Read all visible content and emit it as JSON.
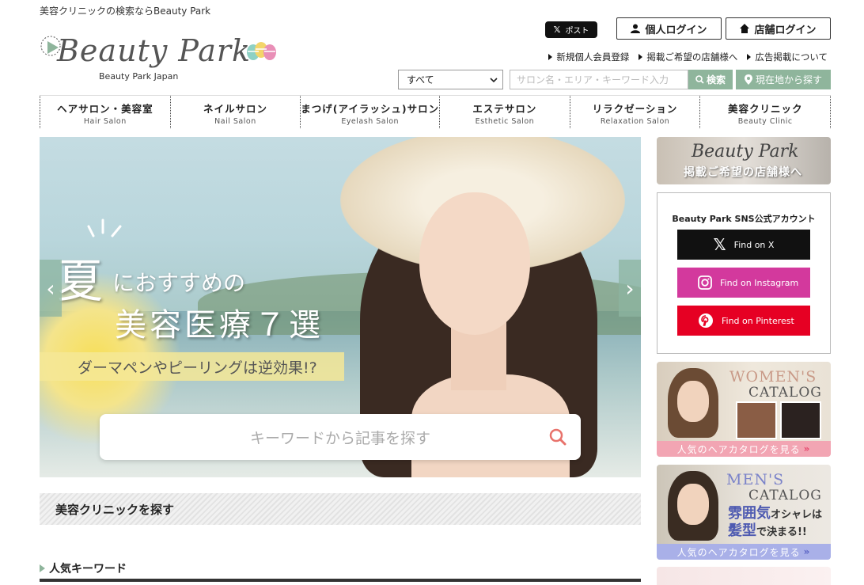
{
  "top_note": "美容クリニックの検索ならBeauty Park",
  "logo": {
    "wordmark": "Beauty Park",
    "sub": "Beauty Park Japan"
  },
  "header": {
    "x_post": "ポスト",
    "login_personal": "個人ログイン",
    "login_shop": "店舗ログイン",
    "links": [
      "新規個人会員登録",
      "掲載ご希望の店舗様へ",
      "広告掲載について"
    ]
  },
  "search": {
    "category": "すべて",
    "placeholder": "サロン名・エリア・キーワード入力",
    "search_btn": "検索",
    "location_btn": "現在地から探す"
  },
  "nav": [
    {
      "jp": "ヘアサロン・美容室",
      "en": "Hair Salon"
    },
    {
      "jp": "ネイルサロン",
      "en": "Nail Salon"
    },
    {
      "jp": "まつげ(アイラッシュ)サロン",
      "en": "Eyelash Salon"
    },
    {
      "jp": "エステサロン",
      "en": "Esthetic Salon"
    },
    {
      "jp": "リラクゼーション",
      "en": "Relaxation Salon"
    },
    {
      "jp": "美容クリニック",
      "en": "Beauty Clinic"
    }
  ],
  "hero": {
    "summer": "夏",
    "recommend": "におすすめの",
    "title": "美容医療７選",
    "warning": "ダーマペンやピーリングは逆効果!?",
    "search_placeholder": "キーワードから記事を探す",
    "prev": "‹",
    "next": "›"
  },
  "section_title": "美容クリニックを探す",
  "keywords_title": "人気キーワード",
  "side": {
    "banner_logo": "Beauty Park",
    "banner_text": "掲載ご希望の店舗様へ",
    "sns_title": "Beauty Park SNS公式アカウント",
    "sns": {
      "x": "Find on X",
      "instagram": "Find on Instagram",
      "pinterest": "Find on Pinterest"
    },
    "women": {
      "head1": "WOMEN'S",
      "head2": "CATALOG",
      "foot": "人気のヘアカタログを見る"
    },
    "men": {
      "head1": "MEN'S",
      "head2": "CATALOG",
      "slogan1": "雰囲気",
      "slogan1b": "オシャレは",
      "slogan2": "髪型",
      "slogan2b": "で決まる!!",
      "foot": "人気のヘアカタログを見る"
    }
  }
}
